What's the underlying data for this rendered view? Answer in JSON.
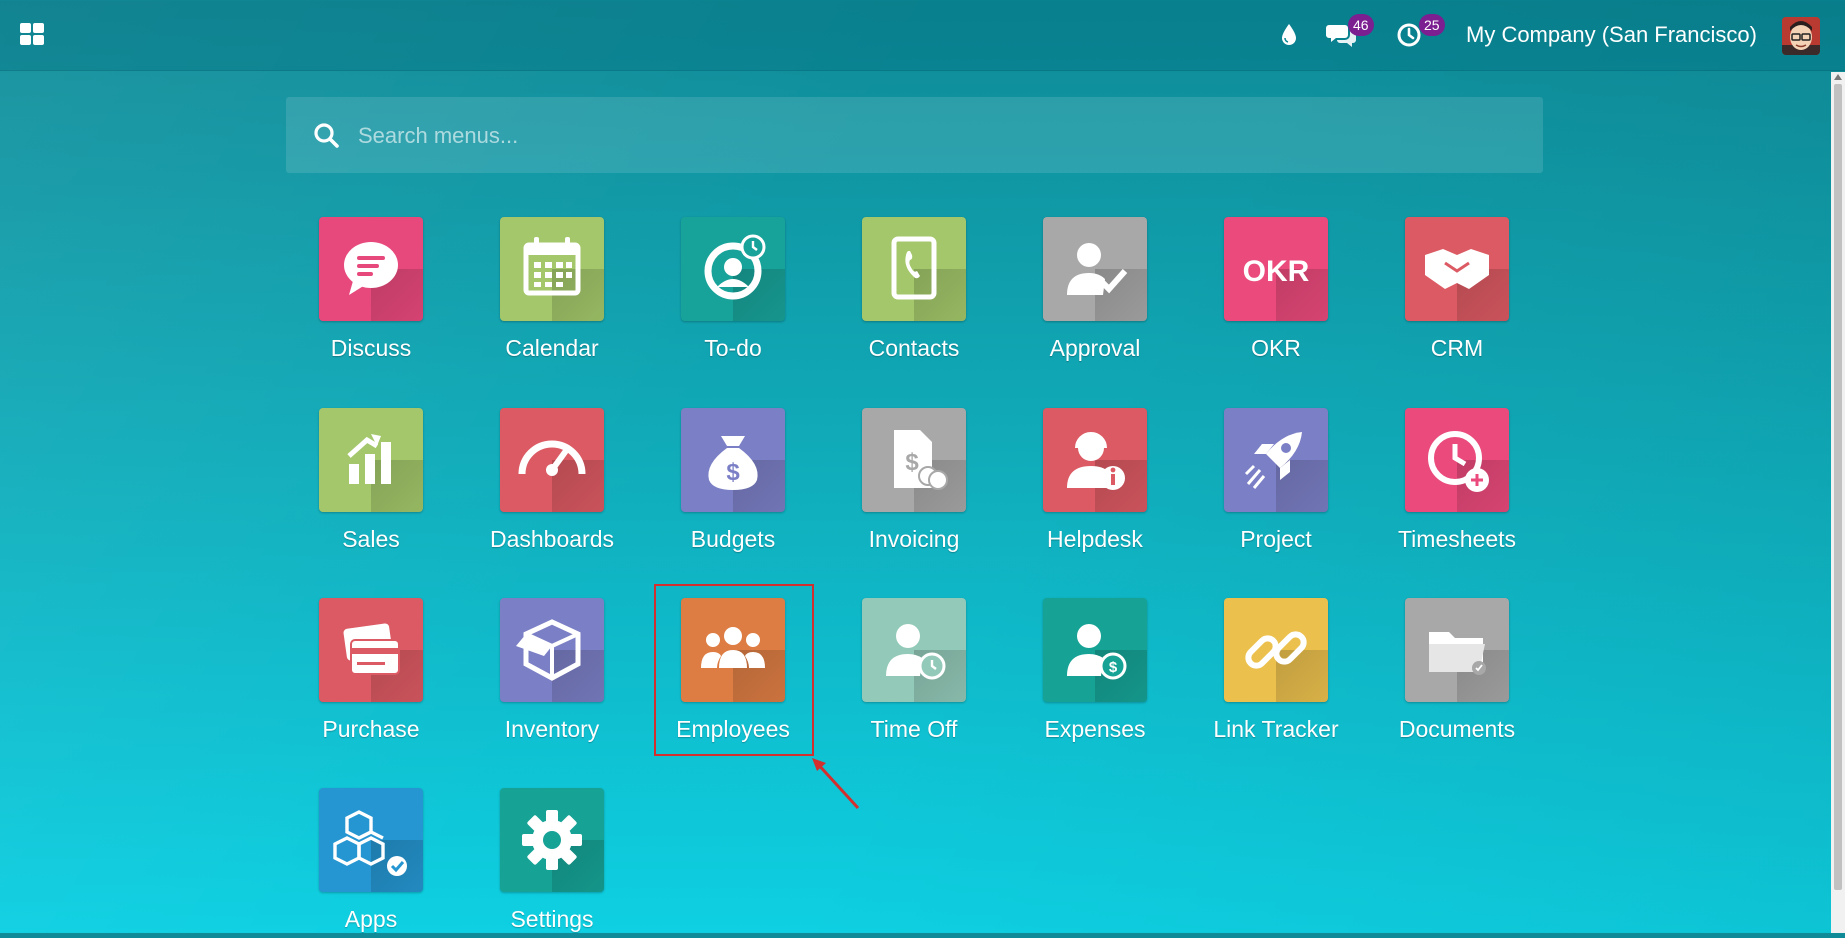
{
  "navbar": {
    "apps_menu_icon": "grid-icon",
    "messages_count": "46",
    "activities_count": "25",
    "company": "My Company (San Francisco)"
  },
  "search": {
    "placeholder": "Search menus..."
  },
  "apps": [
    {
      "label": "Discuss",
      "color": "#e8497c",
      "icon": "chat-bubble-icon"
    },
    {
      "label": "Calendar",
      "color": "#a3c76a",
      "icon": "calendar-icon"
    },
    {
      "label": "To-do",
      "color": "#18a39a",
      "icon": "todo-icon"
    },
    {
      "label": "Contacts",
      "color": "#a3c76a",
      "icon": "address-book-icon"
    },
    {
      "label": "Approval",
      "color": "#a8a8a8",
      "icon": "user-check-icon"
    },
    {
      "label": "OKR",
      "color": "#ea4a7c",
      "icon": "okr-icon"
    },
    {
      "label": "CRM",
      "color": "#dc5a63",
      "icon": "handshake-icon"
    },
    {
      "label": "Sales",
      "color": "#a3c76a",
      "icon": "sales-chart-icon"
    },
    {
      "label": "Dashboards",
      "color": "#dc5a63",
      "icon": "gauge-icon"
    },
    {
      "label": "Budgets",
      "color": "#7b7fc5",
      "icon": "money-bag-icon"
    },
    {
      "label": "Invoicing",
      "color": "#a8a8a8",
      "icon": "invoice-icon"
    },
    {
      "label": "Helpdesk",
      "color": "#dc5a63",
      "icon": "support-agent-icon"
    },
    {
      "label": "Project",
      "color": "#7b7fc5",
      "icon": "rocket-icon"
    },
    {
      "label": "Timesheets",
      "color": "#ea4a7c",
      "icon": "clock-add-icon"
    },
    {
      "label": "Purchase",
      "color": "#dc5a63",
      "icon": "credit-card-icon"
    },
    {
      "label": "Inventory",
      "color": "#7b7fc5",
      "icon": "box-icon"
    },
    {
      "label": "Employees",
      "color": "#dd7d44",
      "icon": "people-icon"
    },
    {
      "label": "Time Off",
      "color": "#93c9b8",
      "icon": "user-clock-icon"
    },
    {
      "label": "Expenses",
      "color": "#16a396",
      "icon": "user-dollar-icon"
    },
    {
      "label": "Link Tracker",
      "color": "#ebc04d",
      "icon": "link-icon"
    },
    {
      "label": "Documents",
      "color": "#a8a8a8",
      "icon": "folder-icon"
    },
    {
      "label": "Apps",
      "color": "#2596d1",
      "icon": "cubes-icon"
    },
    {
      "label": "Settings",
      "color": "#16a396",
      "icon": "gear-icon"
    }
  ]
}
